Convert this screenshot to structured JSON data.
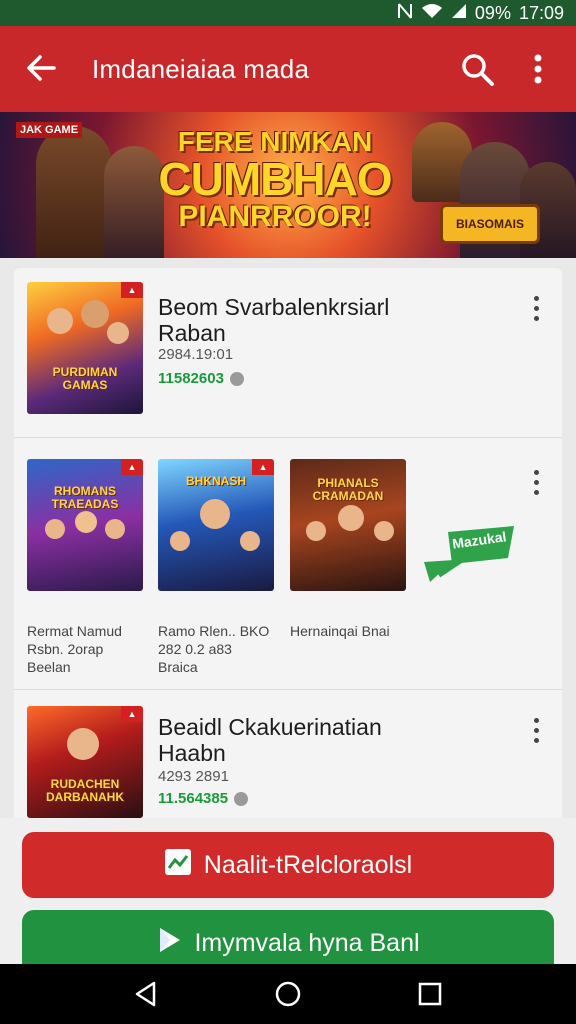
{
  "status_bar": {
    "battery": "09%",
    "time": "17:09"
  },
  "app_bar": {
    "title": "Imdaneiaiaa mada",
    "icons": [
      "back-arrow-icon",
      "search-icon",
      "more-vert-icon"
    ]
  },
  "banner": {
    "corner_tag": "JAK\nGAME",
    "headline_1": "FERE NIMKAN",
    "headline_2": "CUMBHAO",
    "headline_3": "PIANRROOR!",
    "badge": "BIASOMAIS"
  },
  "list": {
    "item_1": {
      "thumb_label": "PURDIMAN GAMAS",
      "title_1": "Beom Svarbalenkrsiarl",
      "title_2": "Raban",
      "date": "2984.19:01",
      "price": "11582603"
    },
    "grid": {
      "cards": [
        {
          "thumb_label": "RHOMANS TRAEADAS",
          "caption_1": "Rermat Namud",
          "caption_2": "Rsbn. 2orap",
          "caption_3": "Beelan"
        },
        {
          "thumb_label": "BHKNASH",
          "caption_1": "Ramo Rlen.. BKO",
          "caption_2": "282 0.2 a83",
          "caption_3": "Braica"
        },
        {
          "thumb_label": "PHIANALS CRAMADAN",
          "caption_1": "Hernainqai Bnai",
          "caption_2": "",
          "caption_3": ""
        }
      ],
      "sticker": "Mazukal"
    },
    "item_3": {
      "thumb_label": "RUDACHEN DARBANAHK",
      "title_1": "Beaidl Ckakuerinatian",
      "title_2": "Haabn",
      "date": "4293 2891",
      "price": "11.564385"
    }
  },
  "buttons": {
    "primary": "Naalit-tRelcloraolsl",
    "secondary": "Imymvala hyna Banl"
  },
  "colors": {
    "app_bar": "#c8282a",
    "status_bar": "#1f5a2f",
    "accent_green": "#21923f",
    "price_green": "#1a9b3a"
  }
}
